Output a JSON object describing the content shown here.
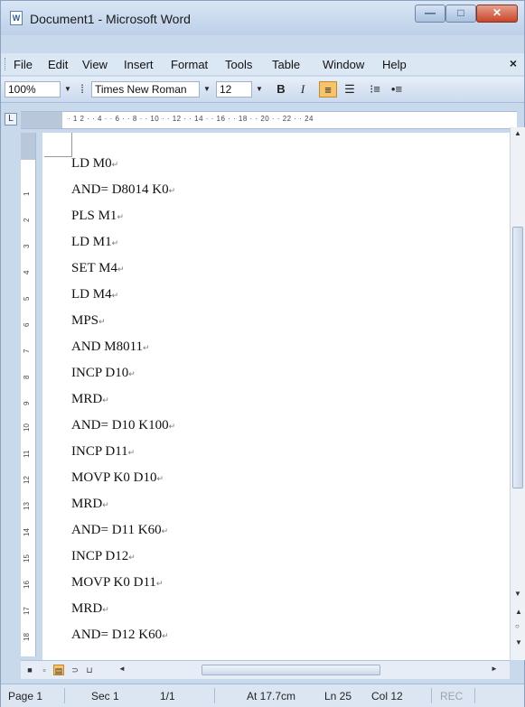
{
  "window": {
    "title": "Document1 - Microsoft Word",
    "app_icon": "W",
    "controls": {
      "minimize": "—",
      "maximize": "□",
      "close": "✕"
    }
  },
  "menu": {
    "items": [
      {
        "label": "File",
        "key": "F"
      },
      {
        "label": "Edit",
        "key": "E"
      },
      {
        "label": "View",
        "key": "V"
      },
      {
        "label": "Insert",
        "key": "I"
      },
      {
        "label": "Format",
        "key": "o"
      },
      {
        "label": "Tools",
        "key": "T"
      },
      {
        "label": "Table",
        "key": "a"
      },
      {
        "label": "Window",
        "key": "W"
      },
      {
        "label": "Help",
        "key": "H"
      }
    ],
    "close_doc": "×"
  },
  "toolbar": {
    "zoom": "100%",
    "font_name": "Times New Roman",
    "font_size": "12",
    "bold": "B",
    "italic": "I",
    "align_left_icon": "align-left-icon",
    "align_center_icon": "align-center-icon",
    "numbering_icon": "numbering-icon",
    "bullets_icon": "bullets-icon"
  },
  "ruler": {
    "horizontal": "· 1 2 · · 4 · · 6 · · 8 · · 10 · · 12 · · 14 · · 16 · · 18 · · 20 · · 22 · · 24",
    "vertical": [
      "1",
      "2",
      "3",
      "4",
      "5",
      "6",
      "7",
      "8",
      "9",
      "10",
      "11",
      "12",
      "13",
      "14",
      "15",
      "16",
      "17",
      "18"
    ]
  },
  "document": {
    "lines": [
      "LD M0",
      "AND= D8014 K0",
      "PLS M1",
      "LD M1",
      "SET M4",
      "LD M4",
      "MPS",
      "AND M8011",
      "INCP D10",
      "MRD",
      "AND= D10 K100",
      "INCP D11",
      "MOVP K0 D10",
      "MRD",
      "AND= D11 K60",
      "INCP D12",
      "MOVP K0 D11",
      "MRD",
      "AND= D12 K60"
    ],
    "paragraph_mark": "↵"
  },
  "status": {
    "page": "Page 1",
    "section": "Sec 1",
    "pages": "1/1",
    "at": "At 17.7cm",
    "line": "Ln 25",
    "col": "Col 12",
    "rec": "REC"
  }
}
